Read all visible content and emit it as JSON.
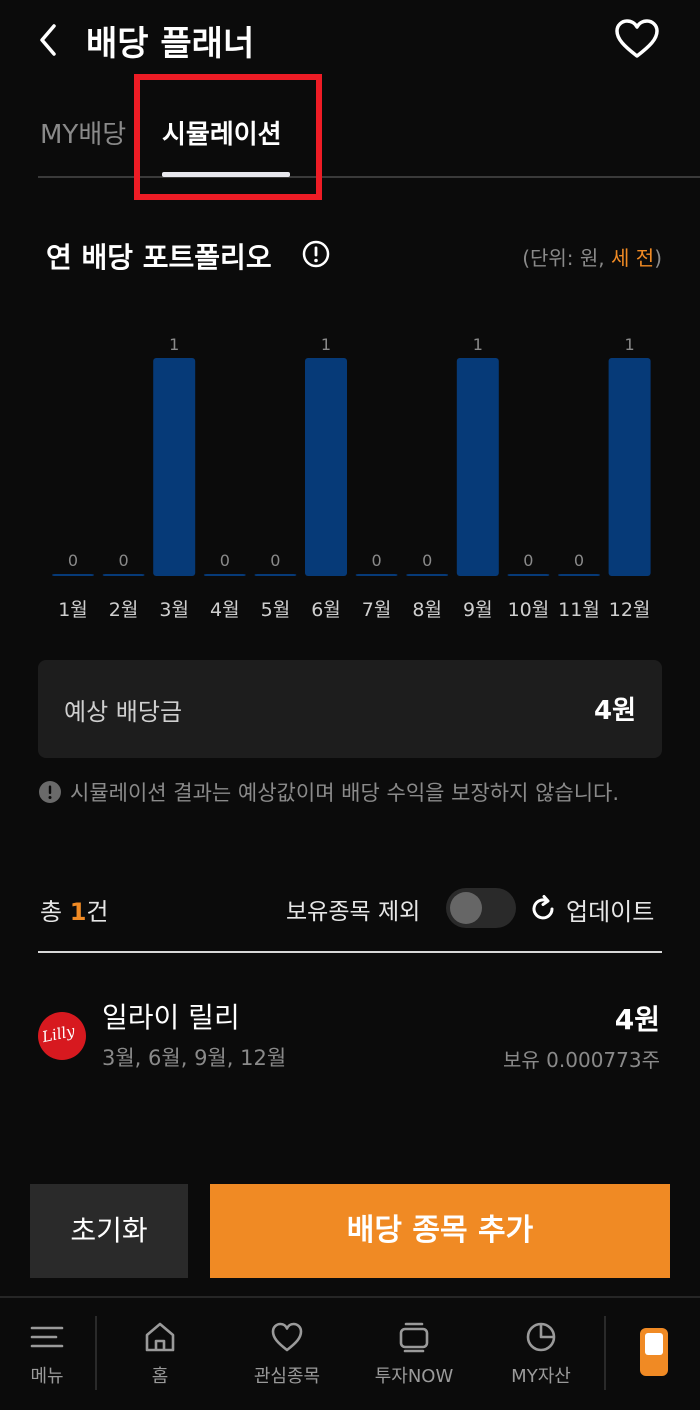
{
  "header": {
    "title": "배당 플래너"
  },
  "tabs": [
    {
      "label": "MY배당",
      "active": false
    },
    {
      "label": "시뮬레이션",
      "active": true
    }
  ],
  "section": {
    "title": "연 배당 포트폴리오",
    "unit_prefix": "(단위: 원, ",
    "unit_accent": "세 전",
    "unit_suffix": ")"
  },
  "chart_data": {
    "type": "bar",
    "categories": [
      "1월",
      "2월",
      "3월",
      "4월",
      "5월",
      "6월",
      "7월",
      "8월",
      "9월",
      "10월",
      "11월",
      "12월"
    ],
    "values": [
      0,
      0,
      1,
      0,
      0,
      1,
      0,
      0,
      1,
      0,
      0,
      1
    ],
    "ylim": [
      0,
      1
    ],
    "grid": false,
    "bar_color": "#063a78"
  },
  "expected": {
    "label": "예상 배당금",
    "value": "4원"
  },
  "notice": {
    "text": "시뮬레이션 결과는 예상값이며 배당 수익을 보장하지 않습니다."
  },
  "list": {
    "total_prefix": "총 ",
    "total_count": "1",
    "total_suffix": "건",
    "exclude_label": "보유종목 제외",
    "update_label": "업데이트"
  },
  "stocks": [
    {
      "name": "일라이 릴리",
      "months": "3월, 6월, 9월, 12월",
      "amount": "4원",
      "holding": "보유 0.000773주",
      "logo_text": "Lilly"
    }
  ],
  "buttons": {
    "reset": "초기화",
    "add": "배당 종목 추가"
  },
  "nav": {
    "menu": "메뉴",
    "home": "홈",
    "watch": "관심종목",
    "now": "투자NOW",
    "assets": "MY자산"
  },
  "colors": {
    "accent": "#f08a24",
    "highlight": "#ee1c25",
    "bar": "#063a78"
  }
}
